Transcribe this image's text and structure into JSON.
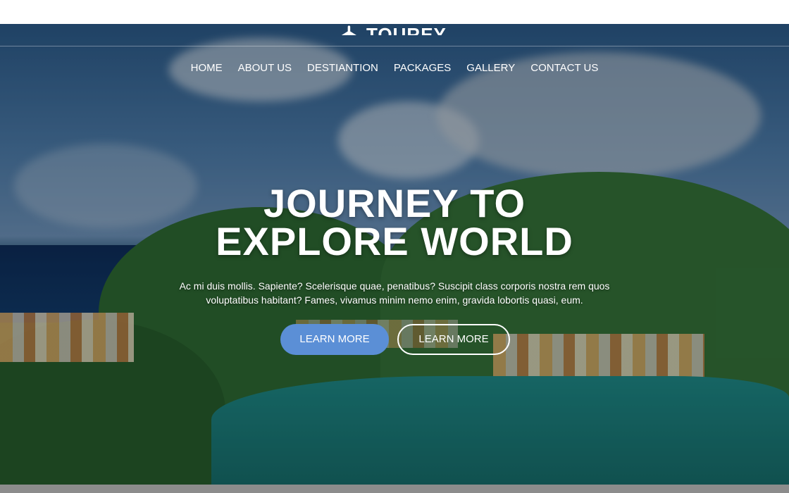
{
  "brand": {
    "name": "TOUREY"
  },
  "nav": {
    "items": [
      "HOME",
      "ABOUT US",
      "DESTIANTION",
      "PACKAGES",
      "GALLERY",
      "CONTACT US"
    ]
  },
  "hero": {
    "title_line1": "JOURNEY TO",
    "title_line2": "EXPLORE WORLD",
    "subtitle_line1": "Ac mi duis mollis. Sapiente? Scelerisque quae, penatibus? Suscipit class corporis nostra rem quos",
    "subtitle_line2": "voluptatibus habitant? Fames, vivamus minim nemo enim, gravida lobortis quasi, eum.",
    "primary_button": "LEARN MORE",
    "secondary_button": "LEARN MORE"
  },
  "colors": {
    "primary_button": "#5b8fd6",
    "text": "#ffffff"
  },
  "icons": {
    "logo": "airplane-icon"
  }
}
